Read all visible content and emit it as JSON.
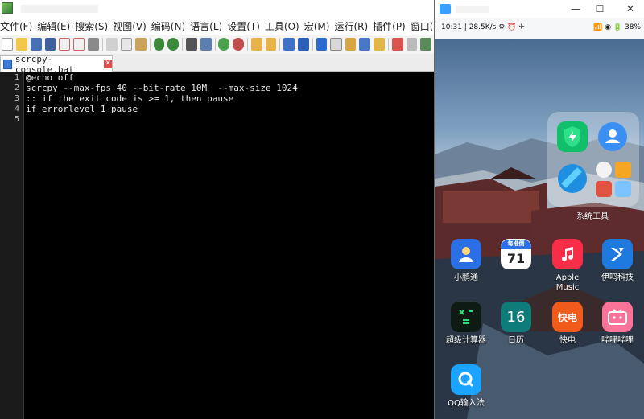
{
  "editor": {
    "menu": [
      "文件(F)",
      "编辑(E)",
      "搜索(S)",
      "视图(V)",
      "编码(N)",
      "语言(L)",
      "设置(T)",
      "工具(O)",
      "宏(M)",
      "运行(R)",
      "插件(P)",
      "窗口("
    ],
    "tab": {
      "label": "scrcpy-console.bat",
      "close_glyph": "✕"
    },
    "lines": [
      {
        "no": "1",
        "text": "@echo off"
      },
      {
        "no": "2",
        "text": "scrcpy --max-fps 40 --bit-rate 10M  --max-size 1024"
      },
      {
        "no": "3",
        "text": ":: if the exit code is >= 1, then pause"
      },
      {
        "no": "4",
        "text": "if errorlevel 1 pause"
      },
      {
        "no": "5",
        "text": ""
      }
    ],
    "colors": {
      "background": "#000000",
      "text": "#e8e8e8",
      "caret_line": "#2b2b2b"
    }
  },
  "phone_window": {
    "controls": {
      "minimize": "—",
      "maximize": "☐",
      "close": "✕"
    },
    "status_bar": {
      "left": "10:31 | 28.5K/s ⚙ ⏰ ✈",
      "right": "📶 ◉ 🔋 38%"
    },
    "folder": {
      "label": "系统工具",
      "apps": [
        "security-icon",
        "contacts-icon",
        "browser-icon",
        "clock-icon",
        "files-icon",
        "theme-icon",
        "weather-icon"
      ]
    },
    "apps": [
      {
        "label": "小鹏通",
        "icon": "person-icon",
        "color": "#2a6fe6"
      },
      {
        "label": "71",
        "sublabel": "每准倒",
        "icon": "calendar-widget-icon",
        "color": "#ffffff"
      },
      {
        "label": "Apple\nMusic",
        "icon": "music-note-icon",
        "color": "#fa2d48"
      },
      {
        "label": "伊鸣科技",
        "icon": "arrow-logo-icon",
        "color": "#1f7ae0"
      },
      {
        "label": "超级计算器",
        "icon": "calculator-icon",
        "color": "#0e1b14"
      },
      {
        "label": "日历",
        "day": "16",
        "icon": "calendar-icon",
        "color": "#0e7d7a"
      },
      {
        "label": "快电",
        "icon": "kuaidian-icon",
        "color": "#f05a1a"
      },
      {
        "label": "哔哩哔哩",
        "icon": "bilibili-icon",
        "color": "#fb7299"
      },
      {
        "label": "QQ输入法",
        "icon": "qq-input-icon",
        "color": "#1aa3ff"
      }
    ]
  }
}
